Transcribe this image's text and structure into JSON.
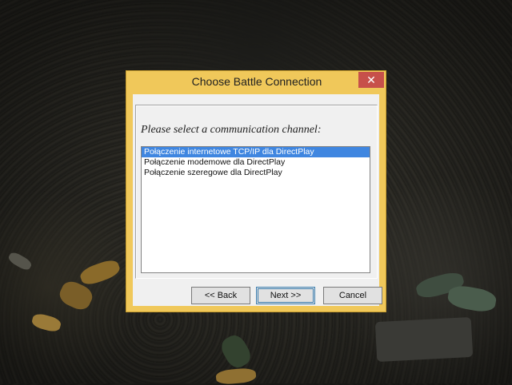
{
  "dialog": {
    "title": "Choose Battle Connection",
    "close_icon": "close-icon",
    "prompt": "Please select a communication channel:",
    "channels": [
      "Połączenie internetowe TCP/IP dla DirectPlay",
      "Połączenie modemowe dla DirectPlay",
      "Połączenie szeregowe dla DirectPlay"
    ],
    "selected_index": 0,
    "buttons": {
      "back": "<< Back",
      "next": "Next >>",
      "cancel": "Cancel"
    }
  },
  "colors": {
    "frame": "#f0c85a",
    "close_button": "#c7504a",
    "selection": "#3f86e0"
  }
}
